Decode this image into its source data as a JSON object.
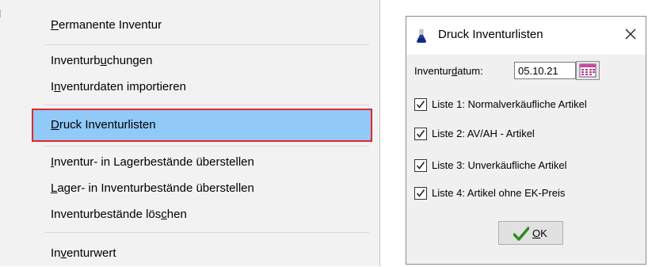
{
  "menu": {
    "items": [
      {
        "label": "Permanente Inventur",
        "accel_index": 0
      },
      {
        "label": "Inventurbuchungen",
        "accel_index": 9
      },
      {
        "label": "Inventurdaten importieren",
        "accel_index": 1
      },
      {
        "label": "Druck Inventurlisten",
        "accel_index": 0
      },
      {
        "label": "Inventur- in Lagerbestände überstellen",
        "accel_index": 0
      },
      {
        "label": "Lager- in Inventurbestände überstellen",
        "accel_index": 0
      },
      {
        "label": "Inventurbestände löschen",
        "accel_index": 20
      },
      {
        "label": "Inventurwert",
        "accel_index": 2
      }
    ]
  },
  "dialog": {
    "title": "Druck Inventurlisten",
    "date_label": "Inventurdatum:",
    "date_label_accel_index": 8,
    "date_value": "05.10.21",
    "checkboxes": [
      {
        "label": "Liste 1: Normalverkäufliche Artikel",
        "checked": true
      },
      {
        "label": "Liste 2: AV/AH - Artikel",
        "checked": true
      },
      {
        "label": "Liste 3: Unverkäufliche Artikel",
        "checked": true
      },
      {
        "label": "Liste 4: Artikel ohne EK-Preis",
        "checked": true
      }
    ],
    "ok_label": "OK",
    "ok_accel_index": 0
  },
  "colors": {
    "menu_bg": "#f2f2f2",
    "highlight_bg": "#91c9f7",
    "highlight_border": "#e3262b",
    "dialog_bg": "#f0f0f0",
    "ok_check": "#2e8b1e"
  },
  "icons": {
    "dialog": "flask-icon",
    "close": "close-icon",
    "calendar": "calendar-icon",
    "ok": "checkmark-icon"
  }
}
